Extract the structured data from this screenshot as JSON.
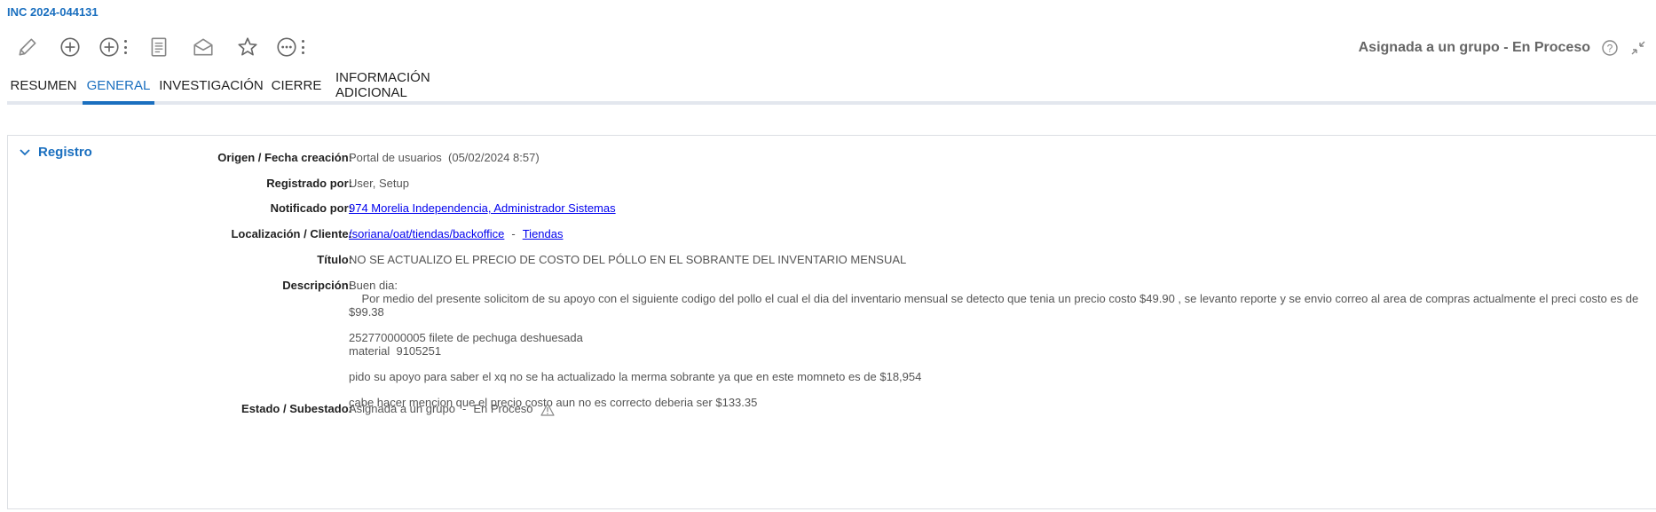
{
  "header": {
    "incident_id": "INC 2024-044131",
    "status": "Asignada a un grupo - En Proceso"
  },
  "toolbar": {
    "icons": [
      "pencil-icon",
      "plus-circle-icon",
      "plus-circle-menu-icon",
      "document-icon",
      "envelope-open-icon",
      "star-icon",
      "more-circle-menu-icon"
    ]
  },
  "tabs": [
    {
      "label": "RESUMEN",
      "active": false
    },
    {
      "label": "GENERAL",
      "active": true
    },
    {
      "label": "INVESTIGACIÓN",
      "active": false
    },
    {
      "label": "CIERRE",
      "active": false
    },
    {
      "label": "INFORMACIÓN ADICIONAL",
      "active": false
    }
  ],
  "section": {
    "title": "Registro",
    "fields": {
      "origen": {
        "label": "Origen / Fecha creación:",
        "value": "Portal de usuarios",
        "date": "(05/02/2024 8:57)"
      },
      "registrado": {
        "label": "Registrado por:",
        "value": "User, Setup"
      },
      "notificado": {
        "label": "Notificado por:",
        "link": "974 Morelia Independencia, Administrador Sistemas"
      },
      "localizacion": {
        "label": "Localización / Cliente:",
        "link1": "/soriana/oat/tiendas/backoffice",
        "sep": "-",
        "link2": "Tiendas"
      },
      "titulo": {
        "label": "Título:",
        "value": "NO SE ACTUALIZO EL PRECIO DE COSTO DEL PÓLLO EN EL SOBRANTE DEL INVENTARIO MENSUAL"
      },
      "descripcion": {
        "label": "Descripción:",
        "p1": "Buen dia:\n    Por medio del presente solicitom de su apoyo con el siguiente codigo del pollo el cual el dia del inventario mensual se detecto que tenia un precio costo $49.90 , se levanto reporte y se envio correo al area de compras actualmente el preci costo es de $99.38",
        "p2": "252770000005 filete de pechuga deshuesada\nmaterial  9105251",
        "p3": "pido su apoyo para saber el xq no se ha actualizado la merma sobrante ya que en este momneto es de $18,954",
        "p4": "cabe hacer mencion que el precio costo aun no es correcto deberia ser $133.35"
      },
      "estado": {
        "label": "Estado / Subestado:",
        "value1": "Asignada a un grupo",
        "sep": "-",
        "value2": "En Proceso"
      }
    }
  },
  "colors": {
    "accent": "#1a6fbf",
    "link": "#0000ee",
    "label": "#222222",
    "value": "#555555"
  }
}
